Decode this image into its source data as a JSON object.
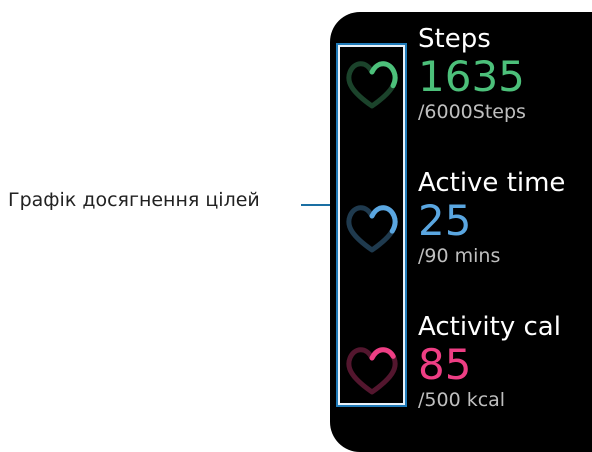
{
  "callout": {
    "label": "Графік досягнення цілей",
    "line_color": "#1a6fa3"
  },
  "metrics": [
    {
      "title": "Steps",
      "value": "1635",
      "goal": "/6000Steps",
      "progress": 0.27,
      "color": "#4cc07a",
      "icon": "heart-progress-icon"
    },
    {
      "title": "Active time",
      "value": "25",
      "goal": "/90 mins",
      "progress": 0.28,
      "color": "#5aa6e0",
      "icon": "heart-progress-icon"
    },
    {
      "title": "Activity cal",
      "value": "85",
      "goal": "/500 kcal",
      "progress": 0.17,
      "color": "#ee3e84",
      "icon": "heart-progress-icon"
    }
  ]
}
